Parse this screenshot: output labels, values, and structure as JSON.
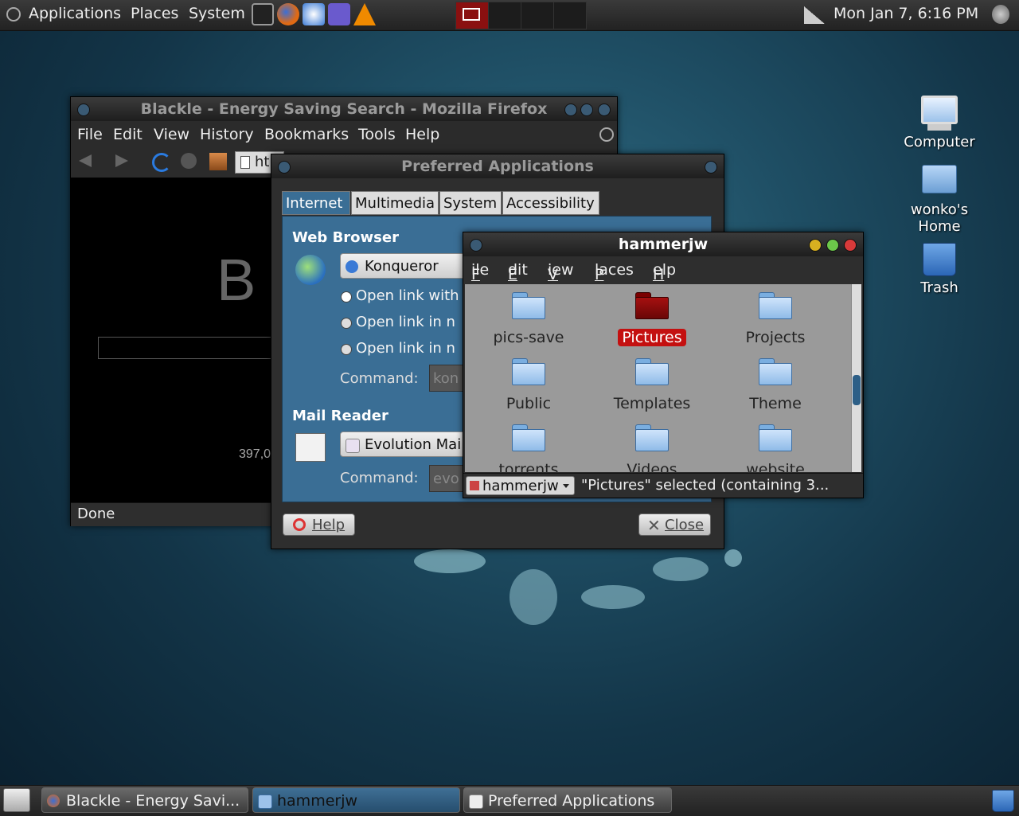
{
  "top_panel": {
    "applications": "Applications",
    "places": "Places",
    "system": "System",
    "clock": "Mon Jan  7,  6:16 PM"
  },
  "desktop": {
    "computer": "Computer",
    "home_line1": "wonko's",
    "home_line2": "Home",
    "trash": "Trash"
  },
  "firefox": {
    "title": "Blackle - Energy Saving Search - Mozilla Firefox",
    "menu": [
      "File",
      "Edit",
      "View",
      "History",
      "Bookmarks",
      "Tools",
      "Help"
    ],
    "url_partial": "ht",
    "logo_partial": "B",
    "count_partial": "397,0",
    "status": "Done"
  },
  "prefapps": {
    "title": "Preferred Applications",
    "tabs": [
      "Internet",
      "Multimedia",
      "System",
      "Accessibility"
    ],
    "web_heading": "Web Browser",
    "web_combo": "Konqueror",
    "radio1": "Open link with",
    "radio2": "Open link in n",
    "radio3": "Open link in n",
    "command_label": "Command:",
    "web_command": "kon",
    "mail_heading": "Mail Reader",
    "mail_combo": "Evolution Mai",
    "mail_command": "evo",
    "help": "Help",
    "close": "Close"
  },
  "nautilus": {
    "title": "hammerjw",
    "menu": [
      "File",
      "Edit",
      "View",
      "Places",
      "Help"
    ],
    "folders": [
      "pics-save",
      "Pictures",
      "Projects",
      "Public",
      "Templates",
      "Theme",
      "torrents",
      "Videos",
      "website"
    ],
    "location": "hammerjw",
    "status": "\"Pictures\" selected (containing 3..."
  },
  "taskbar": {
    "t1": "Blackle - Energy Savi...",
    "t2": "hammerjw",
    "t3": "Preferred Applications"
  }
}
